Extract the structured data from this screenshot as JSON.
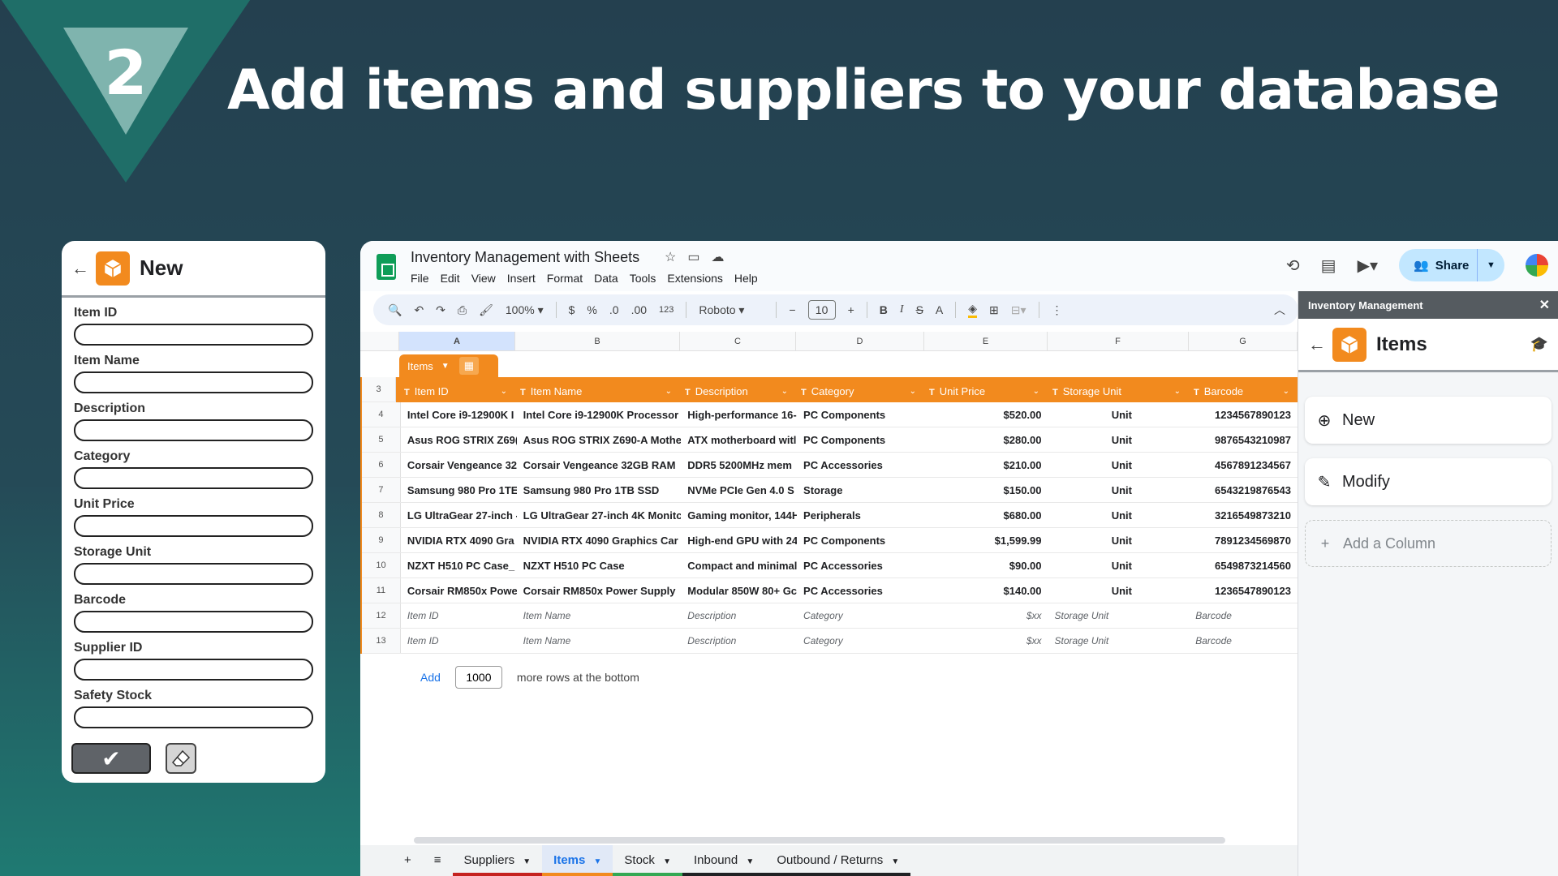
{
  "step": {
    "number": "2",
    "headline": "Add items and suppliers to your database"
  },
  "form": {
    "title": "New",
    "fields": [
      "Item ID",
      "Item Name",
      "Description",
      "Category",
      "Unit Price",
      "Storage Unit",
      "Barcode",
      "Supplier ID",
      "Safety Stock"
    ]
  },
  "sheet": {
    "doc_title": "Inventory Management with Sheets",
    "menu": [
      "File",
      "Edit",
      "View",
      "Insert",
      "Format",
      "Data",
      "Tools",
      "Extensions",
      "Help"
    ],
    "share_label": "Share",
    "zoom": "100%",
    "font": "Roboto",
    "font_size": "10",
    "toolbar_symbols": {
      "currency": "$",
      "percent": "%",
      "dec_less": ".0",
      "dec_more": ".00",
      "format": "123"
    },
    "column_letters": [
      "A",
      "B",
      "C",
      "D",
      "E",
      "F",
      "G"
    ],
    "table_name": "Items",
    "headers": [
      "Item ID",
      "Item Name",
      "Description",
      "Category",
      "Unit Price",
      "Storage Unit",
      "Barcode"
    ],
    "header_row_number": "3",
    "rows": [
      {
        "n": "4",
        "cells": [
          "Intel Core i9-12900K I",
          "Intel Core i9-12900K Processor",
          "High-performance 16-",
          "PC Components",
          "$520.00",
          "Unit",
          "1234567890123"
        ]
      },
      {
        "n": "5",
        "cells": [
          "Asus ROG STRIX Z69(",
          "Asus ROG STRIX Z690-A Mothe",
          "ATX motherboard witl",
          "PC Components",
          "$280.00",
          "Unit",
          "9876543210987"
        ]
      },
      {
        "n": "6",
        "cells": [
          "Corsair Vengeance 32",
          "Corsair Vengeance 32GB RAM",
          "DDR5 5200MHz mem",
          "PC Accessories",
          "$210.00",
          "Unit",
          "4567891234567"
        ]
      },
      {
        "n": "7",
        "cells": [
          "Samsung 980 Pro 1TE",
          "Samsung 980 Pro 1TB SSD",
          "NVMe PCIe Gen 4.0 S",
          "Storage",
          "$150.00",
          "Unit",
          "6543219876543"
        ]
      },
      {
        "n": "8",
        "cells": [
          "LG UltraGear 27-inch -",
          "LG UltraGear 27-inch 4K Monitc",
          "Gaming monitor, 144H",
          "Peripherals",
          "$680.00",
          "Unit",
          "3216549873210"
        ]
      },
      {
        "n": "9",
        "cells": [
          "NVIDIA RTX 4090 Gra",
          "NVIDIA RTX 4090 Graphics Car",
          "High-end GPU with 24",
          "PC Components",
          "$1,599.99",
          "Unit",
          "7891234569870"
        ]
      },
      {
        "n": "10",
        "cells": [
          "NZXT H510 PC Case_",
          "NZXT H510 PC Case",
          "Compact and minimal",
          "PC Accessories",
          "$90.00",
          "Unit",
          "6549873214560"
        ]
      },
      {
        "n": "11",
        "cells": [
          "Corsair RM850x Powe",
          "Corsair RM850x Power Supply",
          "Modular 850W 80+ Gc",
          "PC Accessories",
          "$140.00",
          "Unit",
          "1236547890123"
        ]
      }
    ],
    "placeholder_rows": [
      {
        "n": "12",
        "cells": [
          "Item ID",
          "Item Name",
          "Description",
          "Category",
          "$xx",
          "Storage Unit",
          "Barcode"
        ]
      },
      {
        "n": "13",
        "cells": [
          "Item ID",
          "Item Name",
          "Description",
          "Category",
          "$xx",
          "Storage Unit",
          "Barcode"
        ]
      }
    ],
    "add_rows": {
      "button": "Add",
      "count": "1000",
      "suffix": "more rows at the bottom"
    },
    "tabs": [
      {
        "label": "Suppliers",
        "color": "#c5221f",
        "active": false
      },
      {
        "label": "Items",
        "color": "#f28a1e",
        "active": true
      },
      {
        "label": "Stock",
        "color": "#34a853",
        "active": false
      },
      {
        "label": "Inbound",
        "color": "#202124",
        "active": false
      },
      {
        "label": "Outbound / Returns",
        "color": "#202124",
        "active": false
      }
    ]
  },
  "panel": {
    "header": "Inventory Management",
    "title": "Items",
    "actions": [
      "New",
      "Modify",
      "Add a Column"
    ]
  },
  "colors": {
    "accent": "#f28a1e",
    "background": "#254a57"
  }
}
